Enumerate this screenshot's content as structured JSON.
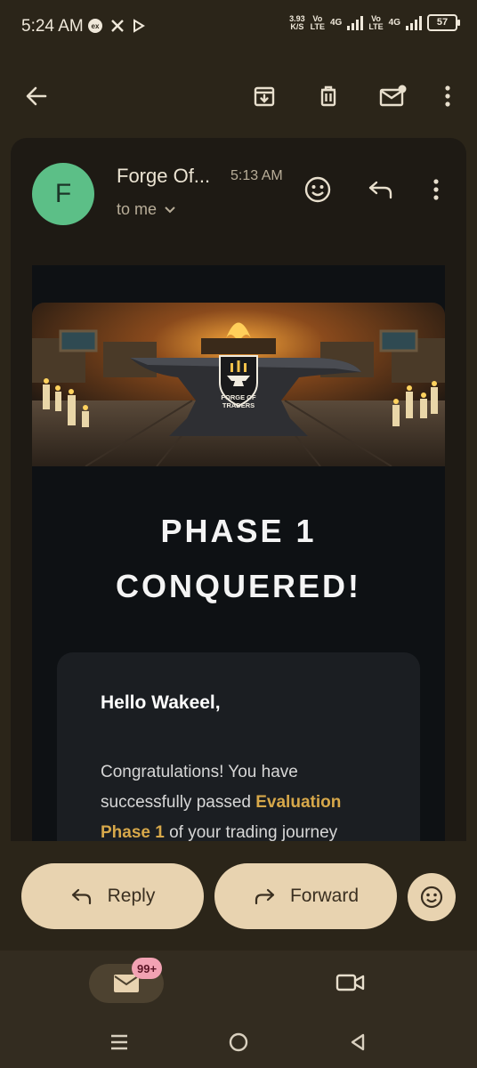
{
  "status_bar": {
    "time": "5:24 AM",
    "speed_value": "3.93",
    "speed_unit": "K/S",
    "volte_1_top": "Vo",
    "volte_1_bottom": "LTE",
    "net_1": "4G",
    "volte_2_top": "Vo",
    "volte_2_bottom": "LTE",
    "net_2": "4G",
    "battery": "57"
  },
  "toolbar": {
    "icons": [
      "back-arrow-icon",
      "archive-icon",
      "delete-icon",
      "mark-unread-icon",
      "more-vert-icon"
    ]
  },
  "email": {
    "avatar_letter": "F",
    "avatar_color": "#5cbf87",
    "sender": "Forge Of...",
    "time": "5:13 AM",
    "recipient": "to me",
    "logo_text_line1": "FORGE OF",
    "logo_text_line2": "TRADERS",
    "headline_line1": "PHASE 1",
    "headline_line2": "CONQUERED!",
    "greeting": "Hello Wakeel,",
    "body_before": "Congratulations! You have successfully passed ",
    "body_highlight": "Evaluation Phase 1",
    "body_after": " of your trading journey",
    "highlight_color": "#d7a84a"
  },
  "actions": {
    "reply_label": "Reply",
    "forward_label": "Forward"
  },
  "bottom_nav": {
    "mail_badge": "99+"
  }
}
